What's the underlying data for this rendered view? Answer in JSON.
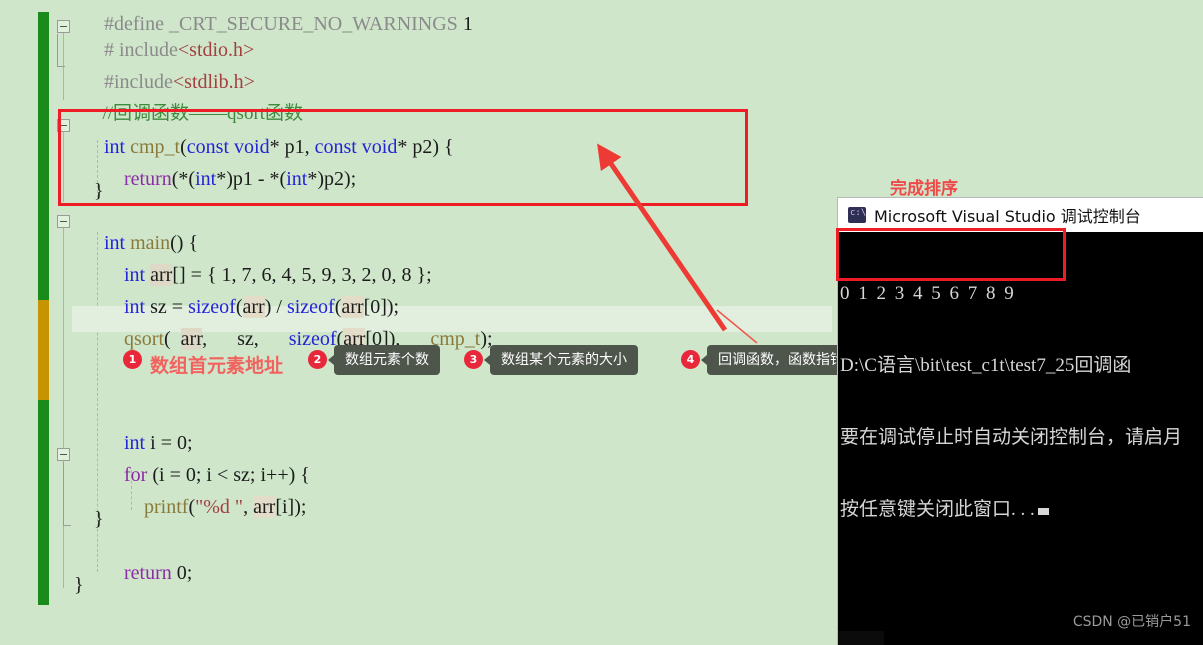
{
  "editor": {
    "code_lines": [
      {
        "id": "l0",
        "text": "#define _CRT_SECURE_NO_WARNINGS 1"
      },
      {
        "id": "l1",
        "text": "# include<stdio.h>"
      },
      {
        "id": "l2",
        "text": "#include<stdlib.h>"
      },
      {
        "id": "l3",
        "text": "//回调函数——qsort函数"
      },
      {
        "id": "l4",
        "text": "int cmp_t(const void* p1, const void* p2) {"
      },
      {
        "id": "l5",
        "text": "    return(*(int*)p1 - *(int*)p2);"
      },
      {
        "id": "l6",
        "text": "    }"
      },
      {
        "id": "l7",
        "text": "int main() {"
      },
      {
        "id": "l8",
        "text": "    int arr[] = { 1, 7, 6, 4, 5, 9, 3, 2, 0, 8 };"
      },
      {
        "id": "l9",
        "text": "    int sz = sizeof(arr) / sizeof(arr[0]);"
      },
      {
        "id": "l10",
        "text": "    qsort(  arr,      sz,      sizeof(arr[0]),      cmp_t);"
      },
      {
        "id": "l11",
        "text": "    int i = 0;"
      },
      {
        "id": "l12",
        "text": "    for (i = 0; i < sz; i++) {"
      },
      {
        "id": "l13",
        "text": "        printf(\"%d \", arr[i]);"
      },
      {
        "id": "l14",
        "text": "    }"
      },
      {
        "id": "l15",
        "text": "    return 0;"
      },
      {
        "id": "l16",
        "text": "}"
      }
    ],
    "tokens": {
      "define_kw": "#define",
      "define_macro": "_CRT_SECURE_NO_WARNINGS",
      "define_val": "1",
      "include1_hash": "# include",
      "include1_file": "<stdio.h>",
      "include2_hash": "#include",
      "include2_file": "<stdlib.h>",
      "comment": "//回调函数——qsort函数",
      "kw_int": "int",
      "fn_cmp": "cmp_t",
      "kw_const": "const",
      "kw_void": "void",
      "p1": "p1",
      "p2": "p2",
      "kw_return": "return",
      "fn_main": "main",
      "id_arr": "arr",
      "array_init": "{ 1, 7, 6, 4, 5, 9, 3, 2, 0, 8 }",
      "id_sz": "sz",
      "kw_sizeof": "sizeof",
      "fn_qsort": "qsort",
      "id_i": "i",
      "kw_for": "for",
      "fn_printf": "printf",
      "fmt_str": "\"%d \"",
      "num_zero": "0"
    }
  },
  "annotations": {
    "red_label_finished": "完成排序",
    "params": [
      {
        "number": "1",
        "label": "数组首元素地址",
        "style": "red-text"
      },
      {
        "number": "2",
        "label": "数组元素个数",
        "style": "tooltip"
      },
      {
        "number": "3",
        "label": "数组某个元素的大小",
        "style": "tooltip"
      },
      {
        "number": "4",
        "label": "回调函数，函数指针",
        "style": "tooltip"
      }
    ],
    "highlight_color": "#ee1c25",
    "badge_color": "#e8273a",
    "tooltip_color": "#4e564c"
  },
  "console": {
    "title": "Microsoft Visual Studio 调试控制台",
    "icon": "console-app-icon",
    "lines": [
      "0 1 2 3 4 5 6 7 8 9",
      "D:\\C语言\\bit\\test_c1t\\test7_25回调函",
      "要在调试停止时自动关闭控制台，请启月",
      "按任意键关闭此窗口. . ."
    ]
  },
  "watermark": {
    "text": "CSDN @已销户51"
  }
}
